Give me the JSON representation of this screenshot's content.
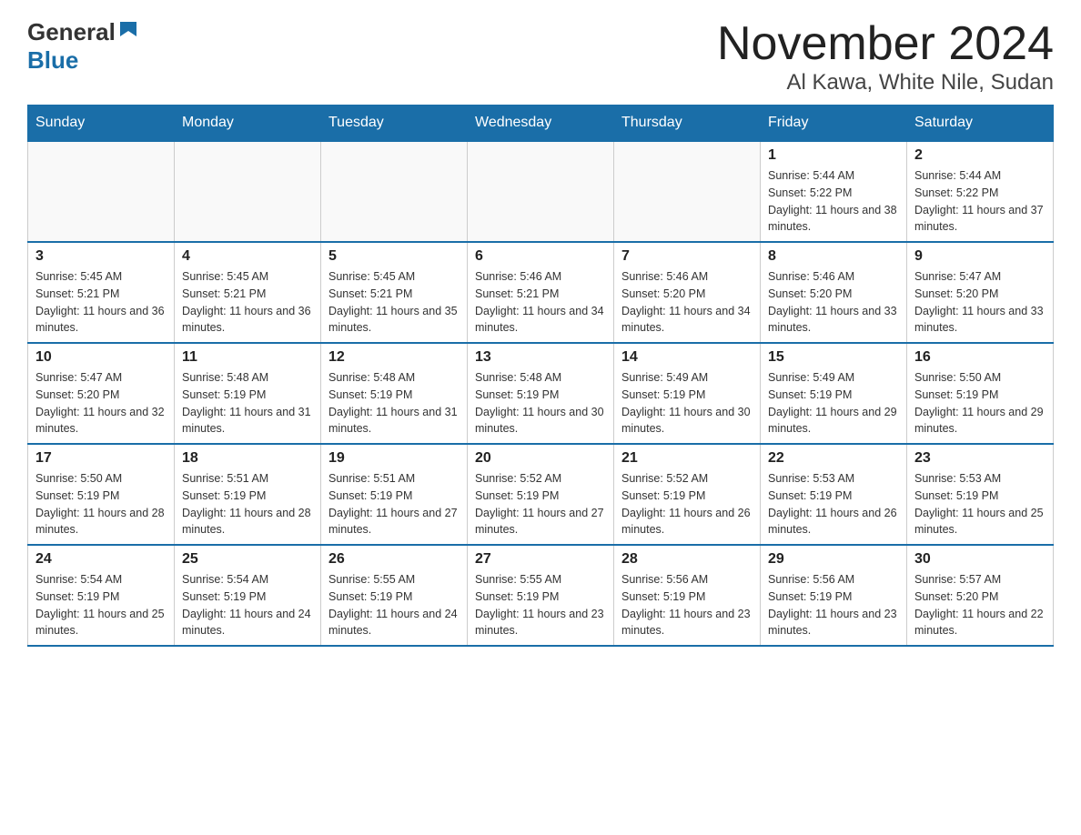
{
  "header": {
    "logo_general": "General",
    "logo_blue": "Blue",
    "title": "November 2024",
    "subtitle": "Al Kawa, White Nile, Sudan"
  },
  "weekdays": [
    "Sunday",
    "Monday",
    "Tuesday",
    "Wednesday",
    "Thursday",
    "Friday",
    "Saturday"
  ],
  "weeks": [
    [
      {
        "day": "",
        "info": ""
      },
      {
        "day": "",
        "info": ""
      },
      {
        "day": "",
        "info": ""
      },
      {
        "day": "",
        "info": ""
      },
      {
        "day": "",
        "info": ""
      },
      {
        "day": "1",
        "info": "Sunrise: 5:44 AM\nSunset: 5:22 PM\nDaylight: 11 hours and 38 minutes."
      },
      {
        "day": "2",
        "info": "Sunrise: 5:44 AM\nSunset: 5:22 PM\nDaylight: 11 hours and 37 minutes."
      }
    ],
    [
      {
        "day": "3",
        "info": "Sunrise: 5:45 AM\nSunset: 5:21 PM\nDaylight: 11 hours and 36 minutes."
      },
      {
        "day": "4",
        "info": "Sunrise: 5:45 AM\nSunset: 5:21 PM\nDaylight: 11 hours and 36 minutes."
      },
      {
        "day": "5",
        "info": "Sunrise: 5:45 AM\nSunset: 5:21 PM\nDaylight: 11 hours and 35 minutes."
      },
      {
        "day": "6",
        "info": "Sunrise: 5:46 AM\nSunset: 5:21 PM\nDaylight: 11 hours and 34 minutes."
      },
      {
        "day": "7",
        "info": "Sunrise: 5:46 AM\nSunset: 5:20 PM\nDaylight: 11 hours and 34 minutes."
      },
      {
        "day": "8",
        "info": "Sunrise: 5:46 AM\nSunset: 5:20 PM\nDaylight: 11 hours and 33 minutes."
      },
      {
        "day": "9",
        "info": "Sunrise: 5:47 AM\nSunset: 5:20 PM\nDaylight: 11 hours and 33 minutes."
      }
    ],
    [
      {
        "day": "10",
        "info": "Sunrise: 5:47 AM\nSunset: 5:20 PM\nDaylight: 11 hours and 32 minutes."
      },
      {
        "day": "11",
        "info": "Sunrise: 5:48 AM\nSunset: 5:19 PM\nDaylight: 11 hours and 31 minutes."
      },
      {
        "day": "12",
        "info": "Sunrise: 5:48 AM\nSunset: 5:19 PM\nDaylight: 11 hours and 31 minutes."
      },
      {
        "day": "13",
        "info": "Sunrise: 5:48 AM\nSunset: 5:19 PM\nDaylight: 11 hours and 30 minutes."
      },
      {
        "day": "14",
        "info": "Sunrise: 5:49 AM\nSunset: 5:19 PM\nDaylight: 11 hours and 30 minutes."
      },
      {
        "day": "15",
        "info": "Sunrise: 5:49 AM\nSunset: 5:19 PM\nDaylight: 11 hours and 29 minutes."
      },
      {
        "day": "16",
        "info": "Sunrise: 5:50 AM\nSunset: 5:19 PM\nDaylight: 11 hours and 29 minutes."
      }
    ],
    [
      {
        "day": "17",
        "info": "Sunrise: 5:50 AM\nSunset: 5:19 PM\nDaylight: 11 hours and 28 minutes."
      },
      {
        "day": "18",
        "info": "Sunrise: 5:51 AM\nSunset: 5:19 PM\nDaylight: 11 hours and 28 minutes."
      },
      {
        "day": "19",
        "info": "Sunrise: 5:51 AM\nSunset: 5:19 PM\nDaylight: 11 hours and 27 minutes."
      },
      {
        "day": "20",
        "info": "Sunrise: 5:52 AM\nSunset: 5:19 PM\nDaylight: 11 hours and 27 minutes."
      },
      {
        "day": "21",
        "info": "Sunrise: 5:52 AM\nSunset: 5:19 PM\nDaylight: 11 hours and 26 minutes."
      },
      {
        "day": "22",
        "info": "Sunrise: 5:53 AM\nSunset: 5:19 PM\nDaylight: 11 hours and 26 minutes."
      },
      {
        "day": "23",
        "info": "Sunrise: 5:53 AM\nSunset: 5:19 PM\nDaylight: 11 hours and 25 minutes."
      }
    ],
    [
      {
        "day": "24",
        "info": "Sunrise: 5:54 AM\nSunset: 5:19 PM\nDaylight: 11 hours and 25 minutes."
      },
      {
        "day": "25",
        "info": "Sunrise: 5:54 AM\nSunset: 5:19 PM\nDaylight: 11 hours and 24 minutes."
      },
      {
        "day": "26",
        "info": "Sunrise: 5:55 AM\nSunset: 5:19 PM\nDaylight: 11 hours and 24 minutes."
      },
      {
        "day": "27",
        "info": "Sunrise: 5:55 AM\nSunset: 5:19 PM\nDaylight: 11 hours and 23 minutes."
      },
      {
        "day": "28",
        "info": "Sunrise: 5:56 AM\nSunset: 5:19 PM\nDaylight: 11 hours and 23 minutes."
      },
      {
        "day": "29",
        "info": "Sunrise: 5:56 AM\nSunset: 5:19 PM\nDaylight: 11 hours and 23 minutes."
      },
      {
        "day": "30",
        "info": "Sunrise: 5:57 AM\nSunset: 5:20 PM\nDaylight: 11 hours and 22 minutes."
      }
    ]
  ]
}
